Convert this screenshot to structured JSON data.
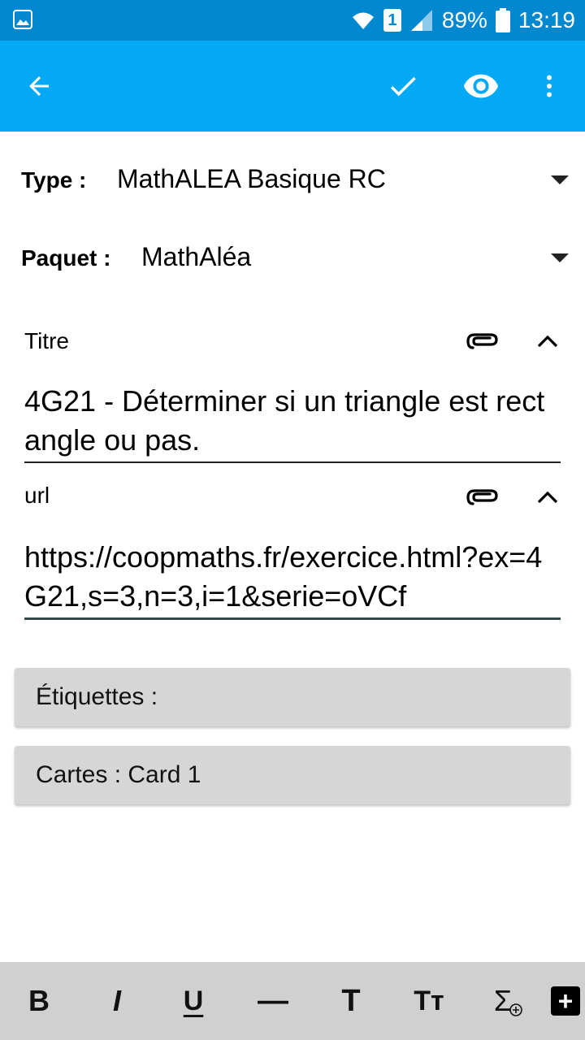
{
  "status_bar": {
    "sim": "1",
    "battery": "89%",
    "time": "13:19"
  },
  "app_bar": {
    "back_icon": "arrow-left-icon",
    "save_icon": "check-icon",
    "preview_icon": "eye-icon",
    "more_icon": "more-vertical-icon"
  },
  "type_row": {
    "label": "Type :",
    "value": "MathALEA Basique RC"
  },
  "deck_row": {
    "label": "Paquet :",
    "value": "MathAléa"
  },
  "fields": [
    {
      "label": "Titre",
      "value": "4G21 - Déterminer si un triangle est rectangle ou pas."
    },
    {
      "label": "url",
      "value": "https://coopmaths.fr/exercice.html?ex=4G21,s=3,n=3,i=1&serie=oVCf"
    }
  ],
  "tags_panel": {
    "label": "Étiquettes :"
  },
  "cards_panel": {
    "label": "Cartes : Card 1"
  },
  "toolbar": {
    "bold": "B",
    "italic": "I",
    "underline": "U",
    "hr": "—",
    "title": "T",
    "font_size": "Tт",
    "mathjax": "Σ",
    "add": "+"
  },
  "colors": {
    "status_bar": "#0288d1",
    "app_bar": "#03a9f4",
    "panel": "#d6d6d6",
    "toolbar": "#d0d0d0"
  }
}
